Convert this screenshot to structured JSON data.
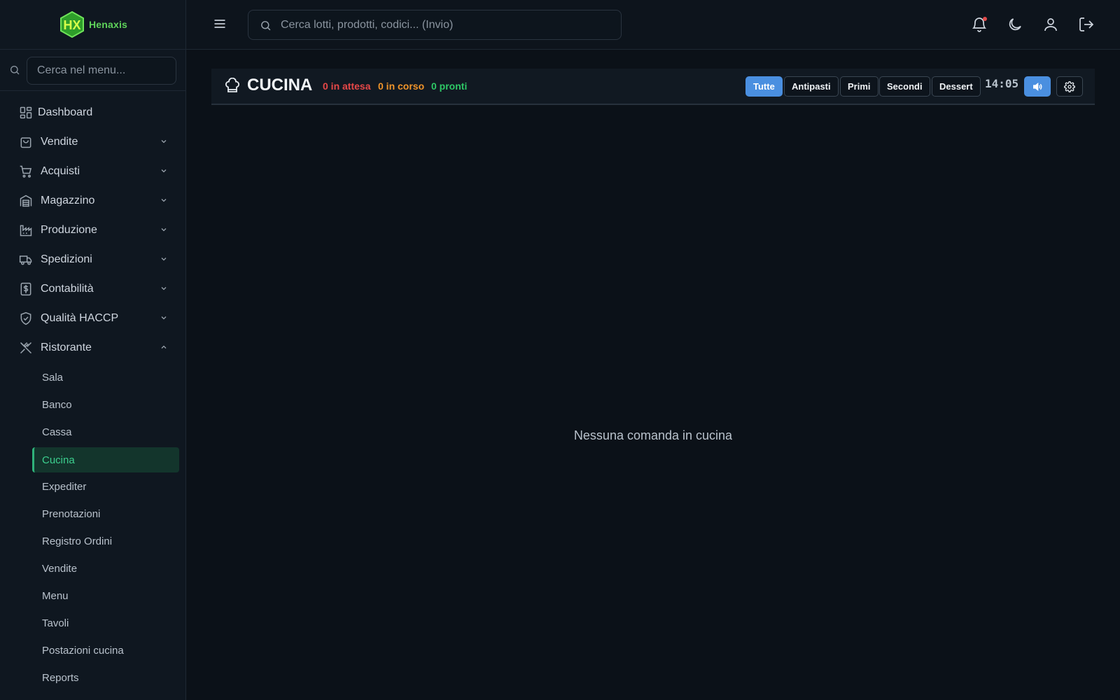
{
  "brand": {
    "name": "Henaxis",
    "mark": "HX"
  },
  "sidebar": {
    "search_placeholder": "Cerca nel menu...",
    "items": [
      {
        "label": "Dashboard",
        "icon": "dashboard-icon"
      },
      {
        "label": "Vendite",
        "icon": "shopping-bag-icon"
      },
      {
        "label": "Acquisti",
        "icon": "cart-icon"
      },
      {
        "label": "Magazzino",
        "icon": "warehouse-icon"
      },
      {
        "label": "Produzione",
        "icon": "factory-icon"
      },
      {
        "label": "Spedizioni",
        "icon": "truck-icon"
      },
      {
        "label": "Contabilità",
        "icon": "dollar-file-icon"
      },
      {
        "label": "Qualità HACCP",
        "icon": "shield-check-icon"
      },
      {
        "label": "Ristorante",
        "icon": "utensils-icon"
      }
    ],
    "ristorante_subitems": [
      "Sala",
      "Banco",
      "Cassa",
      "Cucina",
      "Expediter",
      "Prenotazioni",
      "Registro Ordini",
      "Vendite",
      "Menu",
      "Tavoli",
      "Postazioni cucina",
      "Reports"
    ],
    "active_subitem": "Cucina"
  },
  "topbar": {
    "search_placeholder": "Cerca lotti, prodotti, codici... (Invio)",
    "icons": [
      "bell-icon",
      "moon-icon",
      "user-icon",
      "logout-icon"
    ]
  },
  "kitchen": {
    "title": "CUCINA",
    "stats": {
      "waiting": "0 in attesa",
      "in_progress": "0 in corso",
      "ready": "0 pronti"
    },
    "filters": [
      "Tutte",
      "Antipasti",
      "Primi",
      "Secondi",
      "Dessert"
    ],
    "active_filter": "Tutte",
    "clock": "14:05",
    "empty_message": "Nessuna comanda in cucina"
  },
  "colors": {
    "accent_blue": "#4a8fe0",
    "waiting_red": "#e74848",
    "progress_orange": "#f0942a",
    "ready_green": "#2ec866",
    "active_menu_green": "#3ccf8e"
  }
}
